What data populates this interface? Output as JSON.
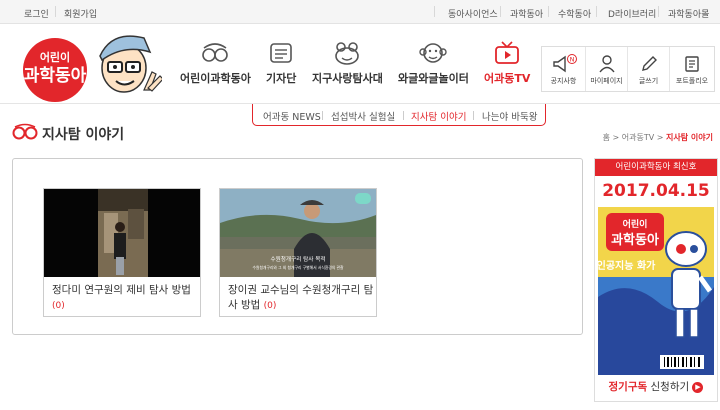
{
  "topbar": {
    "login": "로그인",
    "signup": "회원가입",
    "links": [
      "동아사이언스",
      "과학동아",
      "수학동아",
      "D라이브러리",
      "과학동아몰"
    ]
  },
  "logo": {
    "line1": "어린이",
    "line2": "과학동아"
  },
  "nav": [
    {
      "label": "어린이과학동아",
      "icon": "goggles-icon"
    },
    {
      "label": "기자단",
      "icon": "reporter-badge-icon"
    },
    {
      "label": "지구사랑탐사대",
      "icon": "frog-icon"
    },
    {
      "label": "와글와글놀이터",
      "icon": "monkey-icon"
    },
    {
      "label": "어과동TV",
      "icon": "tv-icon",
      "active": true
    }
  ],
  "tools": [
    {
      "label": "공지사항",
      "icon": "megaphone-icon",
      "badge": "N"
    },
    {
      "label": "마이페이지",
      "icon": "user-icon"
    },
    {
      "label": "글쓰기",
      "icon": "pencil-icon"
    },
    {
      "label": "포트폴리오",
      "icon": "portfolio-icon"
    }
  ],
  "subnav": [
    {
      "label": "어과동 NEWS"
    },
    {
      "label": "섭섭박사 실험실"
    },
    {
      "label": "지사탐 이야기",
      "active": true
    },
    {
      "label": "나는야 바둑왕"
    }
  ],
  "page": {
    "title": "지사탐 이야기"
  },
  "breadcrumb": {
    "home": "홈",
    "sep": ">",
    "parent": "어과동TV",
    "current": "지사탐 이야기"
  },
  "videos": [
    {
      "title": "정다미 연구원의 제비 탐사 방법",
      "count": "(0)"
    },
    {
      "title": "장이권 교수님의 수원청개구리 탐사 방법",
      "count": "(0)",
      "caption_main": "수원청개구리 탐사 목적",
      "caption_sub": "수원청개구리와 그 외 청개구리 구별해서 서식환경의 관찰"
    }
  ],
  "sidebar": {
    "header": "어린이과학동아 최신호",
    "date": "2017.04.15",
    "cover_logo_small": "어린이",
    "cover_logo_big": "과학동아",
    "cover_headline": "인공지능 화가",
    "subscribe_bold": "정기구독",
    "subscribe_rest": " 신청하기",
    "arrow": "▶"
  },
  "colors": {
    "accent": "#e2262b",
    "border": "#cccccc"
  }
}
